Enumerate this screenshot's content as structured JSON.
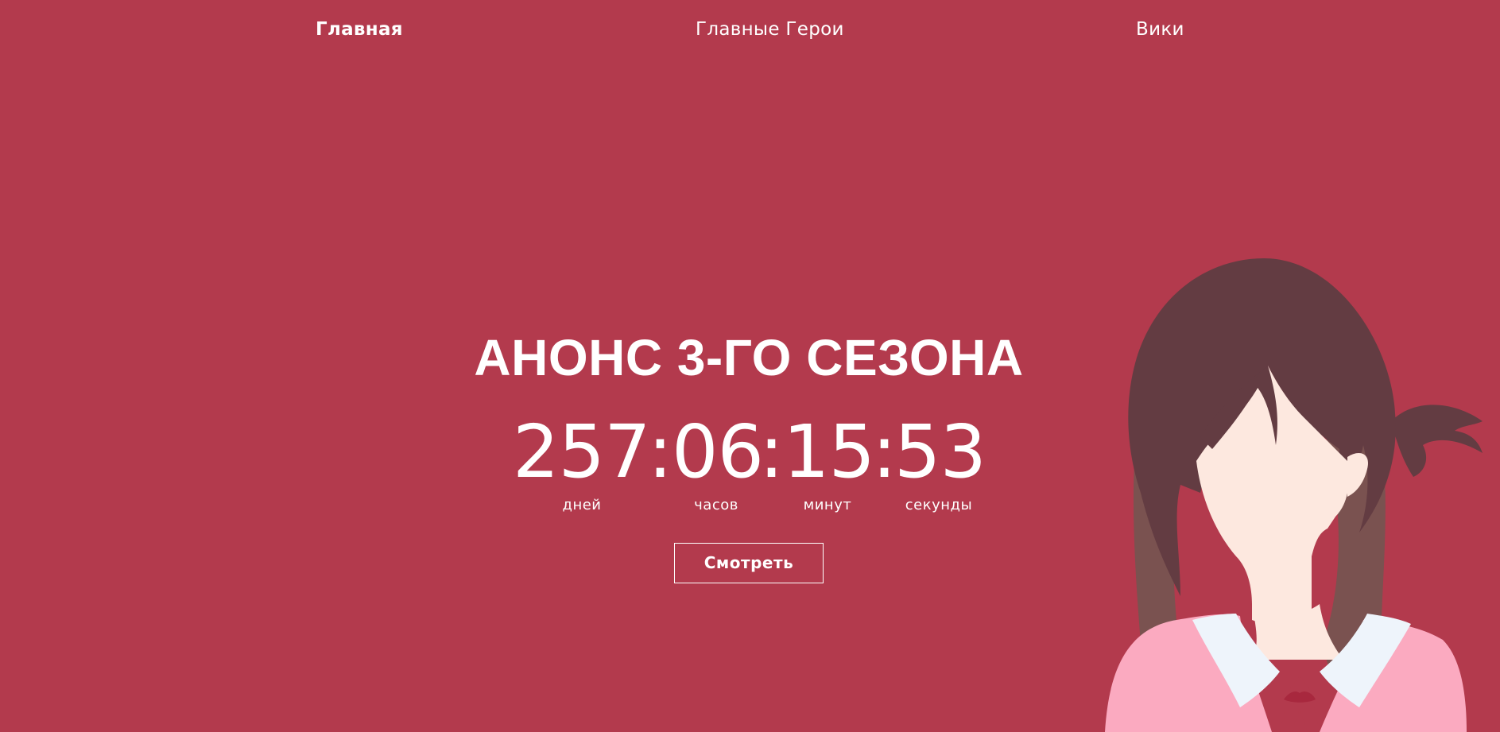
{
  "nav": {
    "items": [
      {
        "label": "Главная",
        "active": true
      },
      {
        "label": "Главные Герои",
        "active": false
      },
      {
        "label": "Вики",
        "active": false
      }
    ]
  },
  "hero": {
    "title": "АНОНС 3-ГО СЕЗОНА",
    "countdown": {
      "days": "257",
      "hours": "06",
      "minutes": "15",
      "seconds": "53",
      "separator": ":",
      "labels": {
        "days": "дней",
        "hours": "часов",
        "minutes": "минут",
        "seconds": "секунды"
      }
    },
    "watch_button": "Смотреть"
  },
  "illustration": {
    "name": "anime-girl-illustration"
  },
  "colors": {
    "background": "#b33a4d",
    "text": "#ffffff",
    "hair": "#633c42",
    "skin": "#fde8df",
    "uniform": "#fbaac0",
    "collar": "#eef4fb",
    "ribbon": "#b33a4d"
  }
}
